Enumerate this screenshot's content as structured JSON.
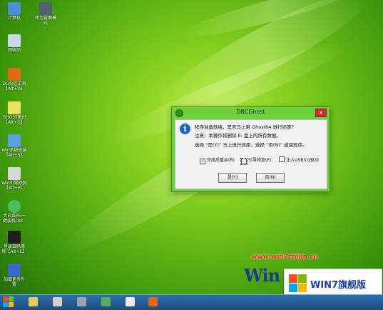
{
  "desktop": {
    "icons": [
      {
        "label": "计算机",
        "icon": "computer-icon",
        "color": "#4a8fd8"
      },
      {
        "label": "回收站",
        "icon": "recycle-bin-icon",
        "color": "#c8d8e8"
      },
      {
        "label": "DG分区工具\n【Alt+D】",
        "icon": "partition-tool-icon",
        "color": "#e06a14"
      },
      {
        "label": "GHOST备份\n【Alt+G】",
        "icon": "ghost-icon",
        "color": "#f0e060"
      },
      {
        "label": "Win系统安装\n【Alt+S】",
        "icon": "installer-icon",
        "color": "#5aa0e0"
      },
      {
        "label": "Win引导修复\n【Alt+F】",
        "icon": "boot-repair-icon",
        "color": "#d8d8d8"
      },
      {
        "label": "大白菜PE一\n键装机(Alt..",
        "icon": "pe-install-icon",
        "color": "#4cbf5a"
      },
      {
        "label": "登录密码清\n除【Alt+C】",
        "icon": "password-clear-icon",
        "color": "#202020"
      },
      {
        "label": "加载更多外\n置",
        "icon": "load-more-icon",
        "color": "#3a6ac8"
      }
    ],
    "icon2": {
      "label": "砖为说面模\n式",
      "icon": "mode-icon",
      "color": "#506070"
    }
  },
  "dialog": {
    "title": "DBCGhost",
    "close_label": "x",
    "line1": "程序准备就绪，是否马上用 Ghost64 进行还原？",
    "line2": "注意：本操作将删除 E: 盘上的所有数据。",
    "line3": "选择 “是(Y)” 马上进行还原，选择 “否(N)” 返回程序。",
    "options": [
      {
        "label": "完成后重启(R)",
        "checked": true
      },
      {
        "label": "引导修复(F)",
        "checked": true
      },
      {
        "label": "注入USB3.0驱动",
        "checked": false
      }
    ],
    "yes_label": "是(Y)",
    "no_label": "否(N)"
  },
  "watermark": {
    "site": "www.win7zhijia.cn",
    "logo_text": "Win",
    "badge_text": "WIN7旗舰版"
  },
  "taskbar": {
    "items": [
      "file-manager-icon",
      "cd-tool-icon",
      "drive-icon",
      "network-icon",
      "text-editor-icon",
      "partition-tool-icon"
    ]
  }
}
